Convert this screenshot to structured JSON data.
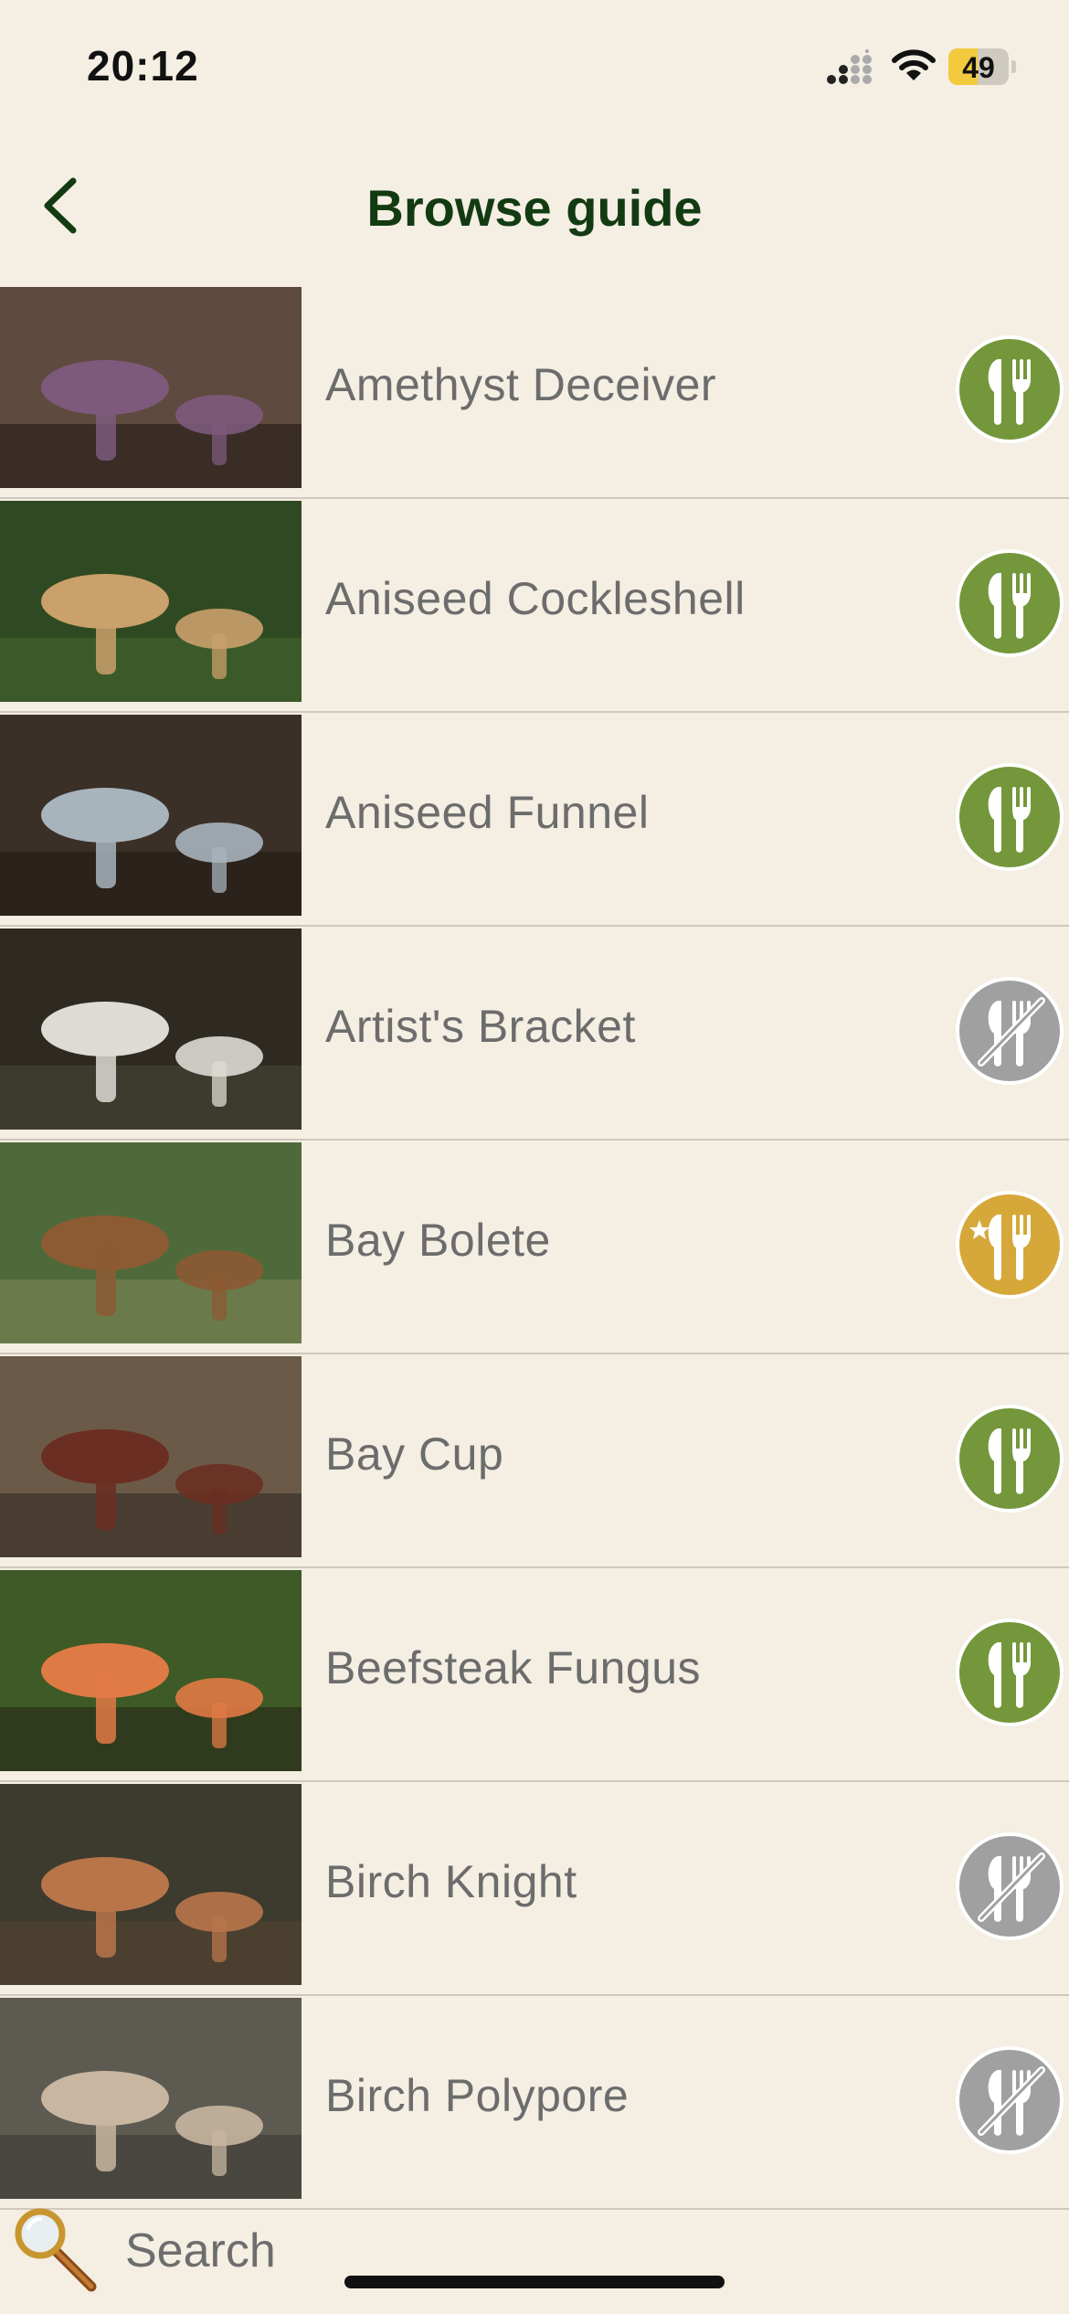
{
  "status_bar": {
    "time": "20:12",
    "battery": "49",
    "battery_level": 0.49
  },
  "nav": {
    "title": "Browse guide"
  },
  "species": [
    {
      "name": "Amethyst Deceiver",
      "edibility": "edible"
    },
    {
      "name": "Aniseed Cockleshell",
      "edibility": "edible"
    },
    {
      "name": "Aniseed Funnel",
      "edibility": "edible"
    },
    {
      "name": "Artist's Bracket",
      "edibility": "inedible"
    },
    {
      "name": "Bay Bolete",
      "edibility": "choice-edible"
    },
    {
      "name": "Bay Cup",
      "edibility": "edible"
    },
    {
      "name": "Beefsteak Fungus",
      "edibility": "edible"
    },
    {
      "name": "Birch Knight",
      "edibility": "inedible"
    },
    {
      "name": "Birch Polypore",
      "edibility": "inedible"
    }
  ],
  "edibility_colors": {
    "edible": "#73973a",
    "inedible": "#a0a0a0",
    "choice-edible": "#d6a83a"
  },
  "search": {
    "placeholder": "Search"
  }
}
